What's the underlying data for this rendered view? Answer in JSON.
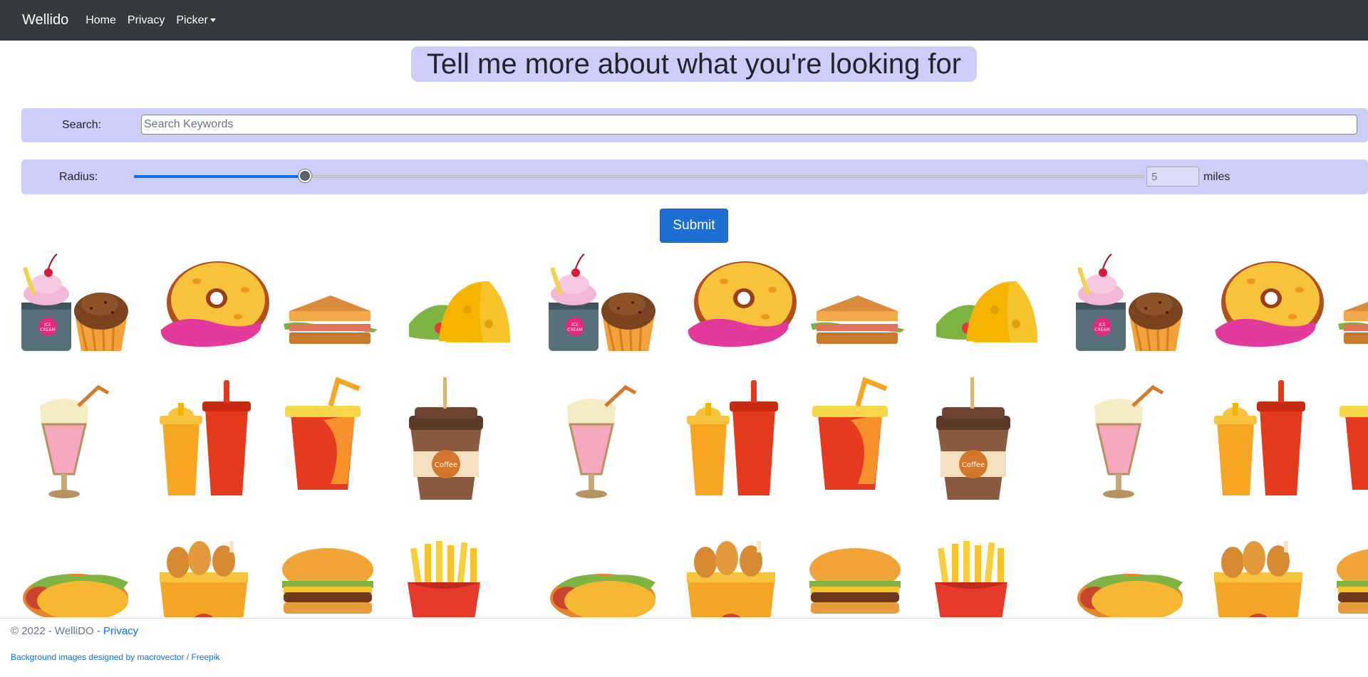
{
  "navbar": {
    "brand": "Wellido",
    "links": [
      "Home",
      "Privacy"
    ],
    "picker_label": "Picker"
  },
  "heading": "Tell me more about what you're looking for",
  "search": {
    "label": "Search:",
    "placeholder": "Search Keywords",
    "value": ""
  },
  "radius": {
    "label": "Radius:",
    "value": "5",
    "fill_fraction": 0.17,
    "unit": "miles"
  },
  "submit_label": "Submit",
  "footer": {
    "copyright": "© 2022 - WelliDO - ",
    "privacy_link": "Privacy",
    "credit": "Background images designed by macrovector / Freepik"
  },
  "food_rows": [
    [
      "ice-cream-muffin",
      "donut",
      "sandwich",
      "taco"
    ],
    [
      "milkshake",
      "soda-cups",
      "soda-straw",
      "coffee-cup"
    ],
    [
      "hot-dog",
      "fried-chicken-bucket",
      "burger",
      "french-fries"
    ]
  ],
  "colors": {
    "navbar": "#343a40",
    "panel": "#cdcdf9",
    "accent": "#0d6efd",
    "submit": "#1c6fd0"
  }
}
